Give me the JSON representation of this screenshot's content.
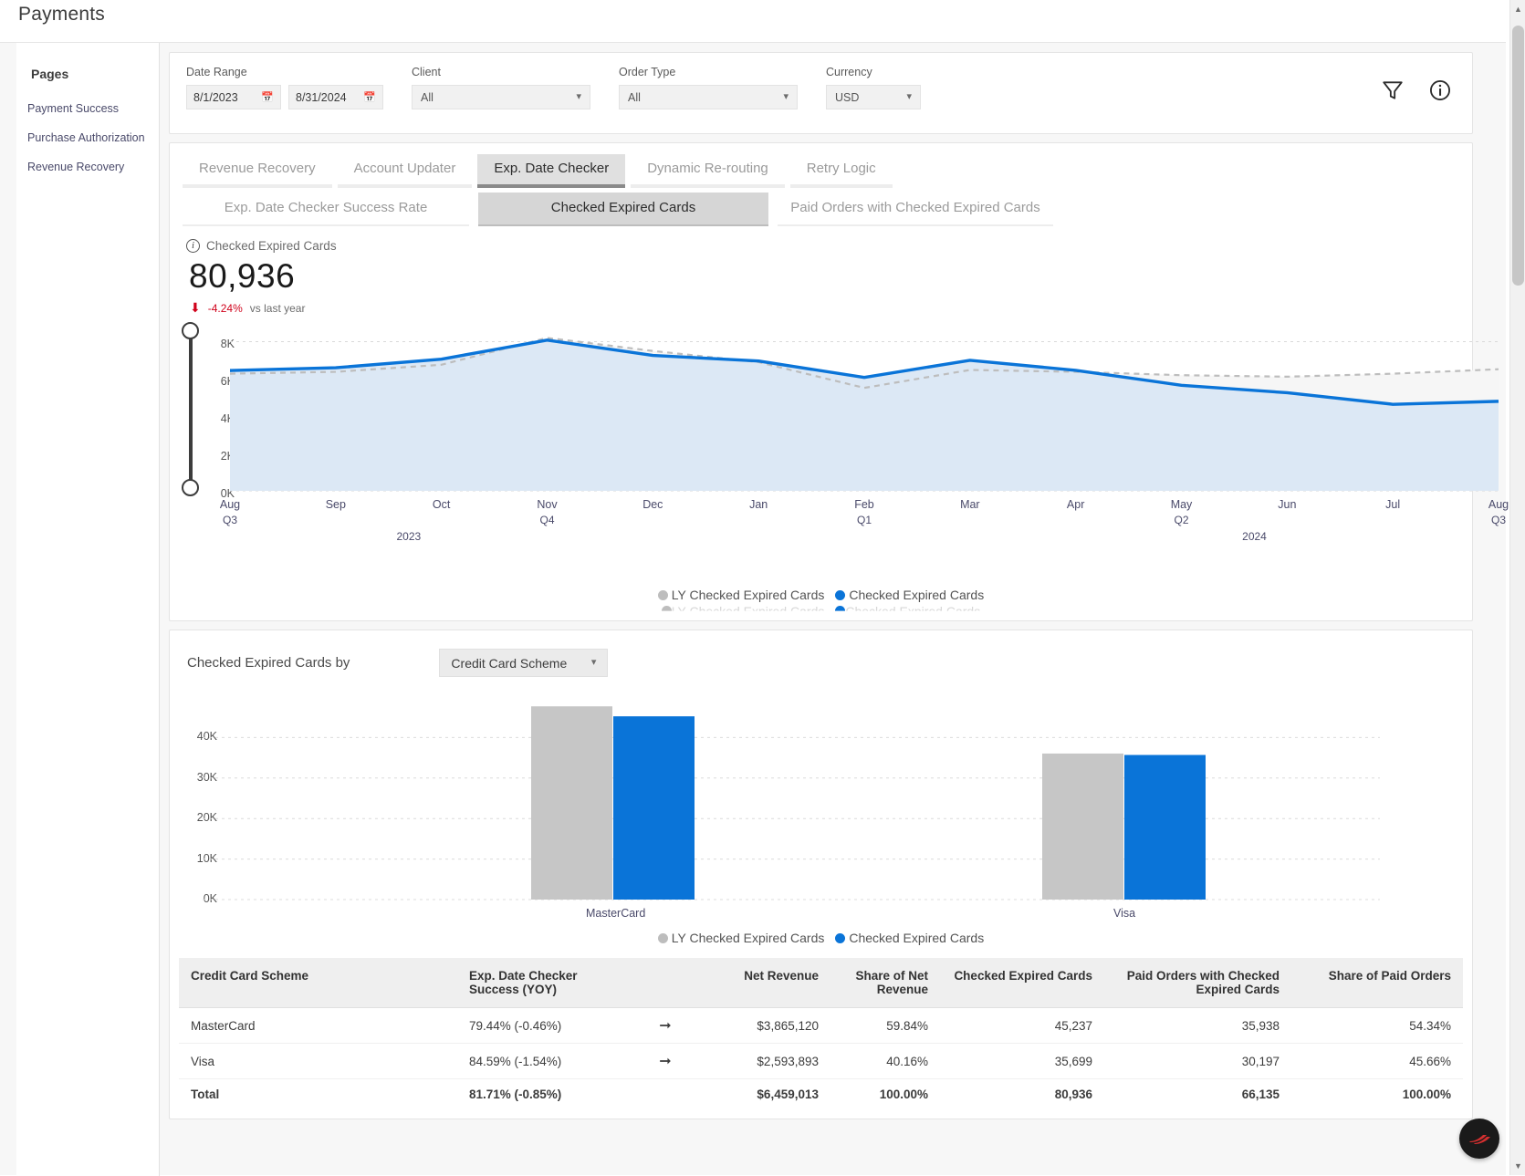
{
  "app": {
    "title": "Payments"
  },
  "sidebar": {
    "header": "Pages",
    "items": [
      {
        "label": "Payment Success"
      },
      {
        "label": "Purchase Authorization"
      },
      {
        "label": "Revenue Recovery"
      }
    ]
  },
  "filters": {
    "date_range": {
      "label": "Date Range",
      "start": "8/1/2023",
      "end": "8/31/2024"
    },
    "client": {
      "label": "Client",
      "value": "All"
    },
    "order_type": {
      "label": "Order Type",
      "value": "All"
    },
    "currency": {
      "label": "Currency",
      "value": "USD"
    },
    "filter_icon": "filter-icon",
    "info_icon": "info-icon"
  },
  "tabs_primary": [
    {
      "label": "Revenue Recovery",
      "active": false
    },
    {
      "label": "Account Updater",
      "active": false
    },
    {
      "label": "Exp. Date Checker",
      "active": true
    },
    {
      "label": "Dynamic Re-routing",
      "active": false
    },
    {
      "label": "Retry Logic",
      "active": false
    }
  ],
  "tabs_secondary": [
    {
      "label": "Exp. Date Checker Success Rate",
      "active": false
    },
    {
      "label": "Checked Expired Cards",
      "active": true
    },
    {
      "label": "Paid Orders with Checked Expired Cards",
      "active": false
    }
  ],
  "kpi": {
    "label": "Checked Expired Cards",
    "value": "80,936",
    "delta": "-4.24%",
    "delta_note": "vs last year",
    "delta_direction": "down",
    "delta_color": "#d0021b"
  },
  "breakdown": {
    "label": "Checked Expired Cards by",
    "dimension": "Credit Card Scheme"
  },
  "table": {
    "columns": [
      "Credit Card Scheme",
      "Exp. Date Checker Success (YOY)",
      "",
      "Net Revenue",
      "Share of Net Revenue",
      "Checked Expired Cards",
      "Paid Orders with Checked Expired Cards",
      "Share of Paid Orders"
    ],
    "rows": [
      {
        "scheme": "MasterCard",
        "success_yoy": "79.44% (-0.46%)",
        "trend": "arrow-down-right-icon",
        "net_revenue": "$3,865,120",
        "share_net_revenue": "59.84%",
        "checked_expired_cards": "45,237",
        "paid_orders": "35,938",
        "share_paid_orders": "54.34%"
      },
      {
        "scheme": "Visa",
        "success_yoy": "84.59% (-1.54%)",
        "trend": "arrow-down-right-icon",
        "net_revenue": "$2,593,893",
        "share_net_revenue": "40.16%",
        "checked_expired_cards": "35,699",
        "paid_orders": "30,197",
        "share_paid_orders": "45.66%"
      }
    ],
    "total": {
      "scheme": "Total",
      "success_yoy": "81.71% (-0.85%)",
      "trend": "",
      "net_revenue": "$6,459,013",
      "share_net_revenue": "100.00%",
      "checked_expired_cards": "80,936",
      "paid_orders": "66,135",
      "share_paid_orders": "100.00%"
    }
  },
  "chart_data": [
    {
      "type": "area",
      "title": "Checked Expired Cards",
      "xlabel": "",
      "ylabel": "",
      "ylim": [
        0,
        9000
      ],
      "yticks": [
        "0K",
        "2K",
        "4K",
        "6K",
        "8K"
      ],
      "grid": true,
      "legend_position": "bottom",
      "categories": [
        "Aug",
        "Sep",
        "Oct",
        "Nov",
        "Dec",
        "Jan",
        "Feb",
        "Mar",
        "Apr",
        "May",
        "Jun",
        "Jul",
        "Aug"
      ],
      "quarters": [
        "Q3",
        "",
        "",
        "Q4",
        "",
        "",
        "Q1",
        "",
        "",
        "Q2",
        "",
        "",
        "Q3"
      ],
      "years": [
        "2023",
        "2024"
      ],
      "series": [
        {
          "name": "LY Checked Expired Cards",
          "color": "#bdbdbd",
          "style": "dashed",
          "values": [
            6280,
            6380,
            6760,
            8200,
            7500,
            6900,
            5520,
            6480,
            6380,
            6200,
            6120,
            6280,
            6520
          ]
        },
        {
          "name": "Checked Expired Cards",
          "color": "#0a74d8",
          "style": "solid",
          "values": [
            6450,
            6600,
            7060,
            8080,
            7260,
            6960,
            6080,
            7000,
            6460,
            5660,
            5260,
            4640,
            4800
          ]
        }
      ]
    },
    {
      "type": "bar",
      "title": "Checked Expired Cards by Credit Card Scheme",
      "xlabel": "",
      "ylabel": "",
      "ylim": [
        0,
        50000
      ],
      "yticks": [
        "0K",
        "10K",
        "20K",
        "30K",
        "40K"
      ],
      "grid": true,
      "legend_position": "bottom",
      "categories": [
        "MasterCard",
        "Visa"
      ],
      "series": [
        {
          "name": "LY Checked Expired Cards",
          "color": "#c6c6c6",
          "values": [
            47700,
            36050
          ]
        },
        {
          "name": "Checked Expired Cards",
          "color": "#0a74d8",
          "values": [
            45237,
            35699
          ]
        }
      ]
    }
  ],
  "legend": {
    "ly": "LY Checked Expired Cards",
    "cy": "Checked Expired Cards"
  }
}
